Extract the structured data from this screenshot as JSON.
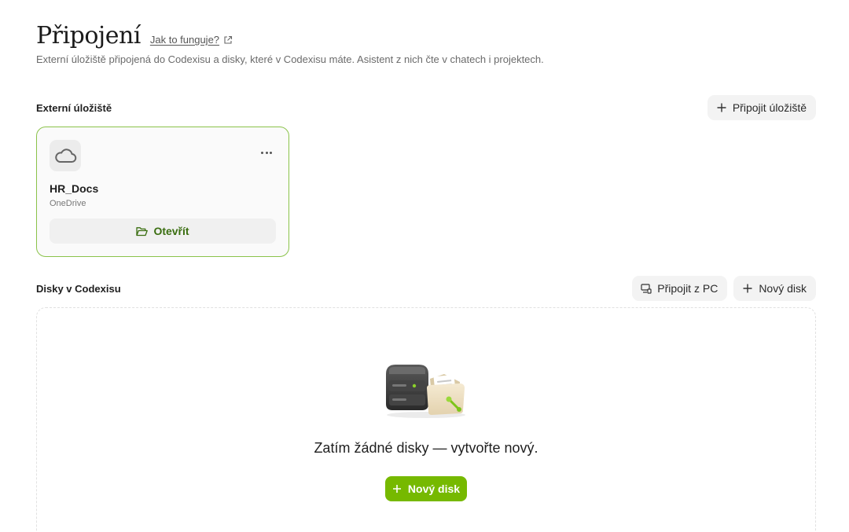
{
  "header": {
    "title": "Připojení",
    "help_link": "Jak to funguje?",
    "subtitle": "Externí úložiště připojená do Codexisu a disky, které v Codexisu máte. Asistent z nich čte v chatech i projektech."
  },
  "external_storage": {
    "section_title": "Externí úložiště",
    "connect_button": "Připojit úložiště",
    "items": [
      {
        "name": "HR_Docs",
        "provider": "OneDrive",
        "icon": "cloud-icon",
        "open_label": "Otevřít"
      }
    ]
  },
  "disks": {
    "section_title": "Disky v Codexisu",
    "connect_pc_button": "Připojit z PC",
    "new_disk_button": "Nový disk",
    "empty_state": {
      "message": "Zatím žádné disky — vytvořte nový.",
      "button": "Nový disk",
      "illustration": "server-folder-illustration"
    }
  },
  "colors": {
    "accent": "#76b900",
    "card_border": "#8bc34a",
    "open_text": "#3a6e10"
  }
}
